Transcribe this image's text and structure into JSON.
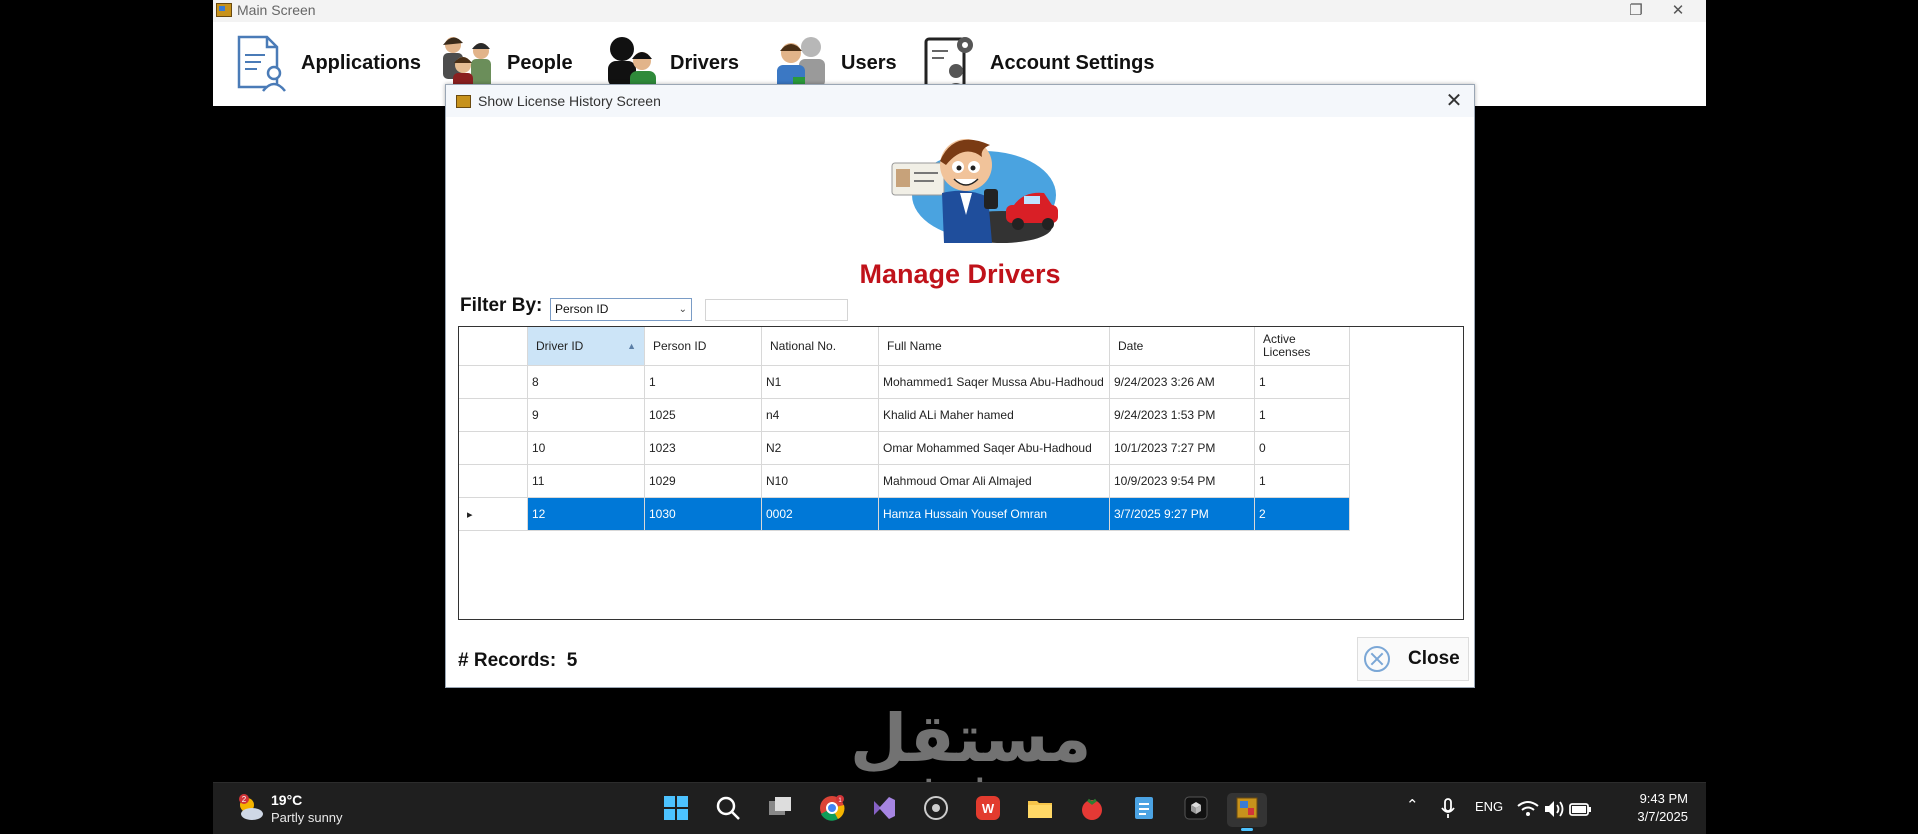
{
  "main_window": {
    "title": "Main Screen",
    "menu": [
      {
        "label": "Applications",
        "icon": "applications-icon"
      },
      {
        "label": "People",
        "icon": "people-icon"
      },
      {
        "label": "Drivers",
        "icon": "drivers-icon"
      },
      {
        "label": "Users",
        "icon": "users-icon"
      },
      {
        "label": "Account Settings",
        "icon": "account-settings-icon"
      }
    ]
  },
  "dialog": {
    "title": "Show License History Screen",
    "heading": "Manage Drivers",
    "filter_label": "Filter By:",
    "filter_selected": "Person ID",
    "filter_value": "",
    "columns": [
      "Driver ID",
      "Person ID",
      "National No.",
      "Full Name",
      "Date",
      "Active\nLicenses"
    ],
    "sorted_column": "Driver ID",
    "rows": [
      [
        "8",
        "1",
        "N1",
        "Mohammed1 Saqer Mussa Abu-Hadhoud",
        "9/24/2023 3:26 AM",
        "1"
      ],
      [
        "9",
        "1025",
        "n4",
        "Khalid ALi Maher hamed",
        "9/24/2023 1:53 PM",
        "1"
      ],
      [
        "10",
        "1023",
        "N2",
        "Omar Mohammed Saqer Abu-Hadhoud",
        "10/1/2023 7:27 PM",
        "0"
      ],
      [
        "11",
        "1029",
        "N10",
        "Mahmoud Omar Ali Almajed",
        "10/9/2023 9:54 PM",
        "1"
      ],
      [
        "12",
        "1030",
        "0002",
        "Hamza Hussain  Yousef Omran",
        "3/7/2025 9:27 PM",
        "2"
      ]
    ],
    "selected_row": 4,
    "records_label": "# Records:",
    "records_count": "5",
    "close_label": "Close",
    "heading_color": "#c0121a",
    "selection_color": "#0078d7"
  },
  "watermark": {
    "arabic": "مستقل",
    "latin": "mostaql.com"
  },
  "taskbar": {
    "weather_badge": "2",
    "temperature": "19°C",
    "weather": "Partly sunny",
    "chrome_badge": "1",
    "language": "ENG",
    "time": "9:43 PM",
    "date": "3/7/2025"
  }
}
